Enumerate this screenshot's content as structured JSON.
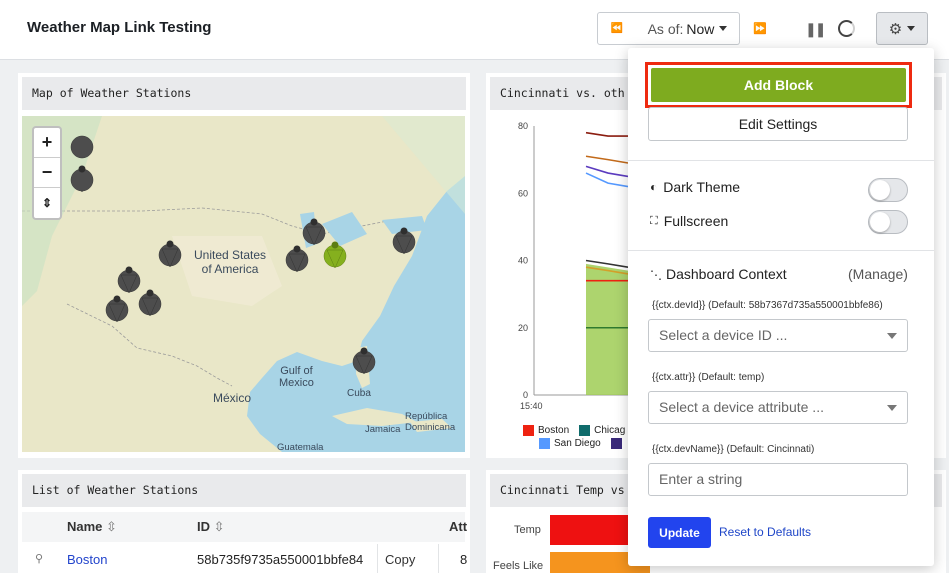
{
  "header": {
    "title": "Weather Map Link Testing",
    "as_of_prefix": "As of:",
    "as_of_value": "Now",
    "rewind_icon": "⏪",
    "ffwd_icon": "⏩",
    "pause_icon": "❚❚",
    "gear_icon": "⚙"
  },
  "map_card": {
    "title": "Map of Weather Stations",
    "zoom_in": "+",
    "zoom_out": "−",
    "reset_north": "⇕",
    "labels": {
      "usa": "United States\nof America",
      "gulf": "Gulf of\nMexico",
      "mexico": "México",
      "cuba": "Cuba",
      "jamaica": "Jamaica",
      "dominicana": "República\nDominicana",
      "guatemala": "Guatemala"
    },
    "marker_count": 10,
    "active_marker_color": "#85b01e",
    "marker_color": "#4d4d4d"
  },
  "line_card": {
    "title": "Cincinnati vs. oth",
    "chart_data": {
      "type": "line",
      "title": "Cincinnati vs. oth",
      "xlabel": "",
      "ylabel": "",
      "x": [
        "15:40"
      ],
      "yticks": [
        0,
        20,
        40,
        60,
        80
      ],
      "ylim": [
        0,
        80
      ],
      "grid": false,
      "legend": [
        "Boston",
        "Chicago",
        "San Diego"
      ],
      "legend_colors": [
        "#ee2211",
        "#106c6c",
        "#5599ff"
      ],
      "series": [
        {
          "name": "Boston",
          "values": [
            39,
            38,
            37
          ]
        },
        {
          "name": "Chicago",
          "values": [
            34,
            34,
            34
          ]
        },
        {
          "name": "San Diego",
          "values": [
            70,
            69,
            68
          ]
        }
      ]
    }
  },
  "list_card": {
    "title": "List of Weather Stations",
    "columns": [
      "Name",
      "ID",
      "Att"
    ],
    "rows": [
      {
        "name": "Boston",
        "id": "58b735f9735a550001bbfe84",
        "action": "Copy",
        "att": "8"
      }
    ]
  },
  "bar_card": {
    "title": "Cincinnati Temp vs",
    "chart_data": {
      "type": "bar",
      "title": "Cincinnati Temp vs",
      "categories": [
        "Temp",
        "Feels Like"
      ],
      "colors": [
        "#ee1111",
        "#f5941e"
      ]
    }
  },
  "settings_menu": {
    "add_block": "Add Block",
    "edit_settings": "Edit Settings",
    "dark_theme": "Dark Theme",
    "fullscreen": "Fullscreen",
    "dashboard_context": "Dashboard Context",
    "manage": "(Manage)",
    "device_id_label": "{{ctx.devId}} (Default: 58b7367d735a550001bbfe86)",
    "device_id_placeholder": "Select a device ID ...",
    "attr_label": "{{ctx.attr}} (Default: temp)",
    "attr_placeholder": "Select a device attribute ...",
    "dev_name_label": "{{ctx.devName}} (Default: Cincinnati)",
    "dev_name_placeholder": "Enter a string",
    "update": "Update",
    "reset": "Reset to Defaults"
  }
}
